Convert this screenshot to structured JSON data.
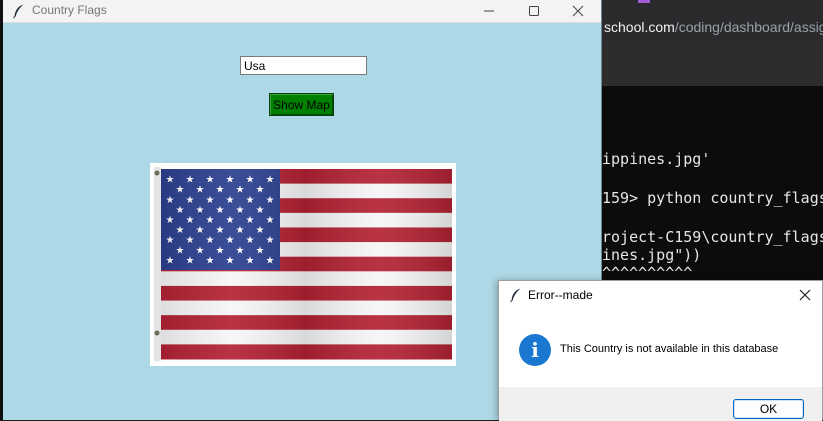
{
  "background": {
    "browser_url_host": "school.com",
    "browser_url_path": "/coding/dashboard/assig",
    "terminal_lines": [
      "ippines.jpg'",
      "159> python country_flags",
      "roject-C159\\country_flags",
      "ines.jpg\"))",
      "^^^^^^^^^^"
    ]
  },
  "main_window": {
    "title": "Country Flags",
    "country_input_value": "Usa",
    "show_map_label": "Show Map",
    "background_color": "#add8e6",
    "button_color": "#008000"
  },
  "flag": {
    "country": "USA",
    "stripe_red": "#b22234",
    "canton_blue": "#2a3f8f",
    "stripe_white": "#f6f6f6"
  },
  "dialog": {
    "title": "Error--made",
    "message": "This Country is not available in this database",
    "ok_label": "OK",
    "icon": "info-icon"
  },
  "icons": {
    "app_icon": "feather-icon",
    "minimize": "minimize-icon",
    "maximize": "maximize-icon",
    "close": "close-icon"
  }
}
